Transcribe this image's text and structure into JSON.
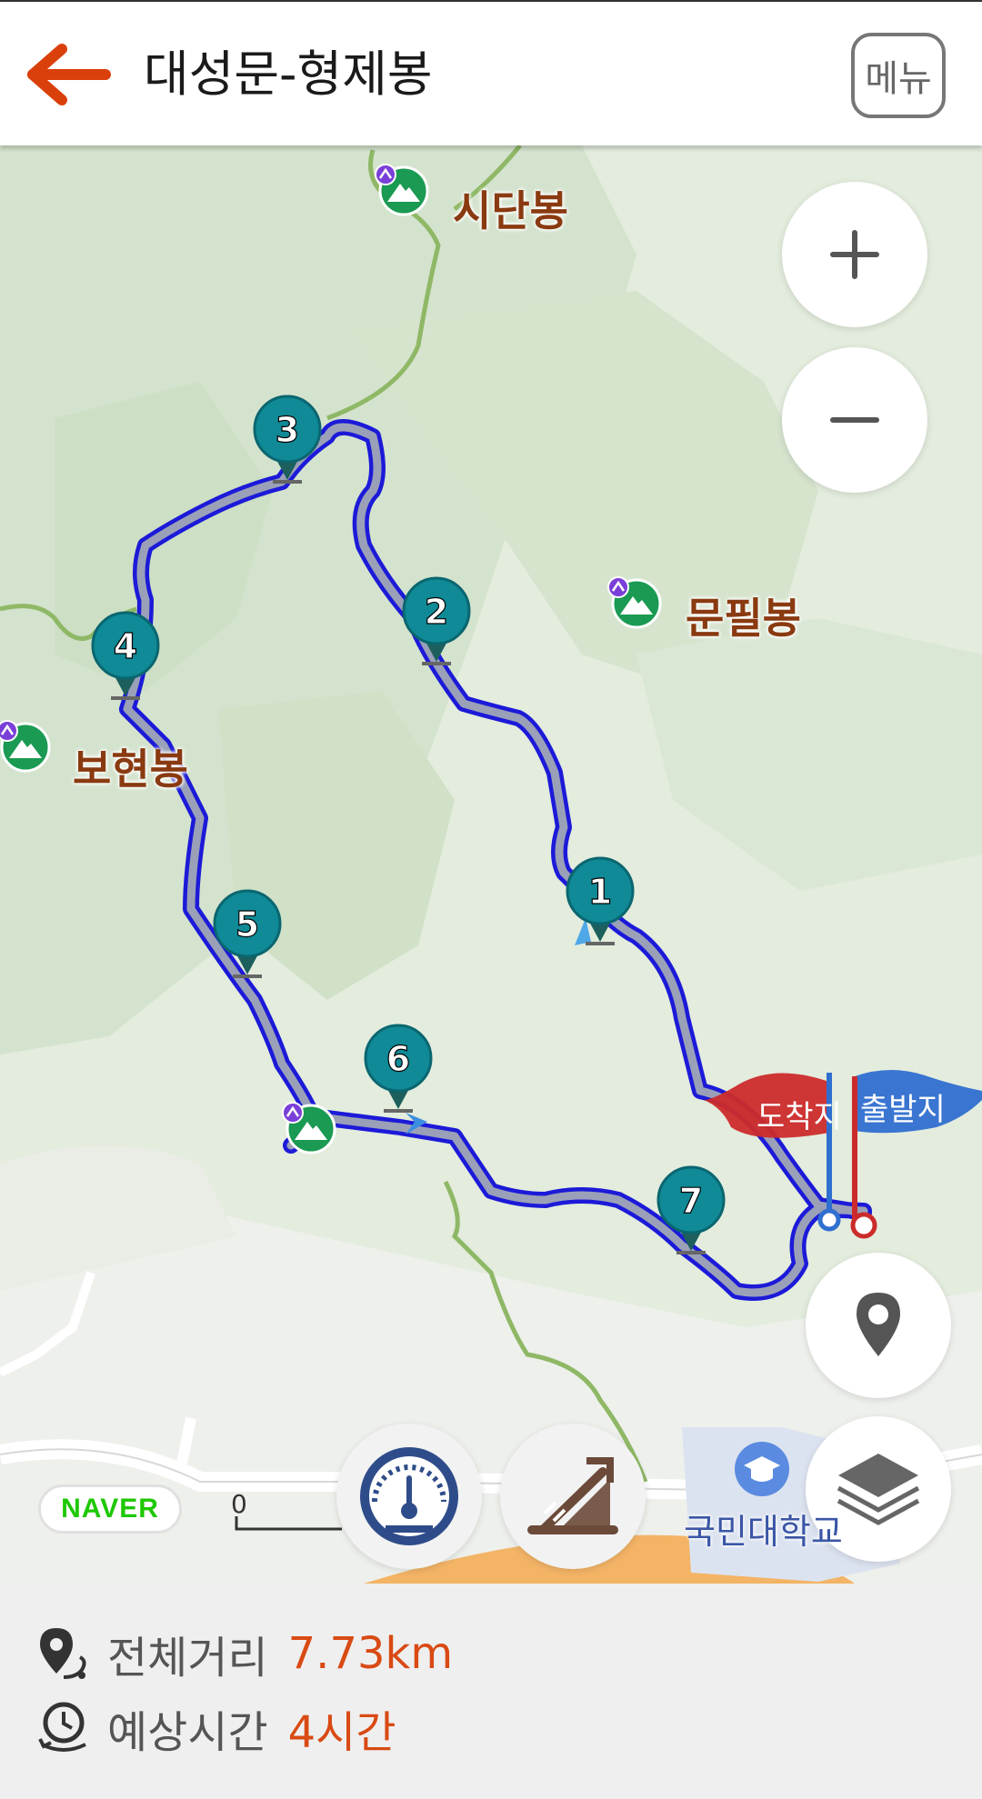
{
  "header": {
    "title": "대성문-형제봉",
    "menu_label": "메뉴",
    "accent": "#d9400c"
  },
  "map": {
    "peaks": [
      {
        "name": "시단봉"
      },
      {
        "name": "문필봉"
      },
      {
        "name": "보현봉"
      }
    ],
    "places": [
      {
        "name": "국민대학교"
      }
    ],
    "waypoints": [
      "1",
      "2",
      "3",
      "4",
      "5",
      "6",
      "7"
    ],
    "flags": {
      "arrival": "도착지",
      "departure": "출발지",
      "arrival_color": "#cc2b2b",
      "departure_color": "#2f6fd0"
    },
    "attribution": "NAVER",
    "scale_start": "0",
    "route_color": "#1c1ad8",
    "waypoint_color": "#0f8a96"
  },
  "controls": {
    "zoom_in_icon": "plus-icon",
    "zoom_out_icon": "minus-icon",
    "location_icon": "location-pin-icon",
    "layers_icon": "layers-icon",
    "speedometer_icon": "speedometer-icon",
    "elevation_icon": "elevation-slope-icon"
  },
  "summary": {
    "distance_label": "전체거리",
    "distance_value": "7.73km",
    "time_label": "예상시간",
    "time_value": "4시간"
  }
}
